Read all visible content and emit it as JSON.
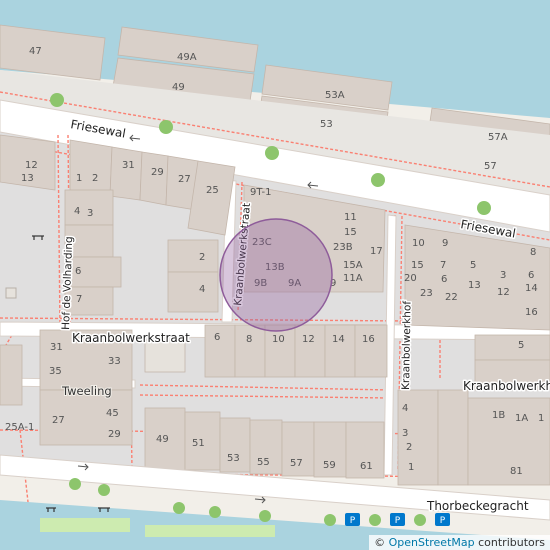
{
  "streets": {
    "friesewal_a": "Friesewal",
    "friesewal_b": "Friesewal",
    "kraanbolwerkstraat_v": "Kraanbolwerkstraat",
    "kraanbolwerkstraat_h": "Kraanbolwerkstraat",
    "hof_de_volharding": "Hof de Volharding",
    "kraanbolwerkhof_v": "Kraanbolwerkhof",
    "kraanbolwerkhof_h": "Kraanbolwerkhof",
    "thorbeckegracht": "Thorbeckegracht"
  },
  "poi": {
    "tweeling": "Tweeling"
  },
  "house_numbers": {
    "h47": "47",
    "h49A": "49A",
    "h49": "49",
    "h53A": "53A",
    "h53": "53",
    "h57A": "57A",
    "h57": "57",
    "h12": "12",
    "h13": "13",
    "h31": "31",
    "h29": "29",
    "h27": "27",
    "h25": "25",
    "h1": "1",
    "h2": "2",
    "h4": "4",
    "h3": "3",
    "h6": "6",
    "h7": "7",
    "h9T1": "9T-1",
    "h11": "11",
    "h15": "15",
    "h23C": "23C",
    "h23B": "23B",
    "h17": "17",
    "h13B": "13B",
    "h15A": "15A",
    "h11A": "11A",
    "h9B": "9B",
    "h9A": "9A",
    "h9": "9",
    "hK2": "2",
    "hK4": "4",
    "hH10": "10",
    "hH9": "9",
    "hH15": "15",
    "hH7": "7",
    "hH5": "5",
    "hH6": "6",
    "hH20": "20",
    "hH23": "23",
    "hH22": "22",
    "hH13": "13",
    "hH12": "12",
    "hH14": "14",
    "hH16": "16",
    "hH3": "3",
    "hH8": "8",
    "hS6": "6",
    "hS8": "8",
    "hS10": "10",
    "hS12": "12",
    "hS14": "14",
    "hS16": "16",
    "hT31": "31",
    "hT33": "33",
    "hT35": "35",
    "hT27": "27",
    "hT45": "45",
    "hT29": "29",
    "h25A1": "25A-1",
    "hB49": "49",
    "hB51": "51",
    "hB53": "53",
    "hB55": "55",
    "hB57": "57",
    "hB59": "59",
    "hB61": "61",
    "hR5": "5",
    "hR4": "4",
    "hR3": "3",
    "hR2": "2",
    "hR1": "1",
    "hR1B": "1B",
    "hR1A": "1A",
    "hR81": "81"
  },
  "parking": [
    "P",
    "P",
    "P"
  ],
  "attribution": {
    "prefix": "© ",
    "link": "OpenStreetMap",
    "suffix": " contributors"
  },
  "colors": {
    "water": "#aad3df",
    "land": "#f2efe9",
    "building": "#d9d0c9",
    "road": "#ffffff",
    "footway": "#fa8072",
    "tree": "#8dc56c",
    "grass": "#cdebb0",
    "residential": "#e0dfdf",
    "marker": "#8e5c9a",
    "parking": "#0078cc"
  },
  "marker": {
    "type": "circle"
  }
}
